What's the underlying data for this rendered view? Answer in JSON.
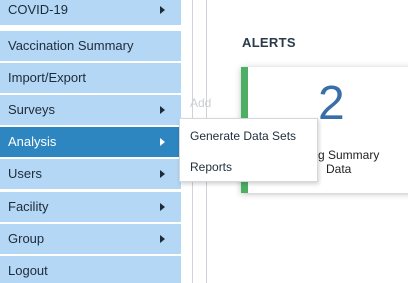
{
  "sidebar": {
    "items": [
      {
        "label": "COVID-19",
        "has_arrow": true,
        "active": false
      },
      {
        "label": "Vaccination Summary",
        "has_arrow": false,
        "active": false
      },
      {
        "label": "Import/Export",
        "has_arrow": false,
        "active": false
      },
      {
        "label": "Surveys",
        "has_arrow": true,
        "active": false
      },
      {
        "label": "Analysis",
        "has_arrow": true,
        "active": true
      },
      {
        "label": "Users",
        "has_arrow": true,
        "active": false
      },
      {
        "label": "Facility",
        "has_arrow": true,
        "active": false
      },
      {
        "label": "Group",
        "has_arrow": true,
        "active": false
      },
      {
        "label": "Logout",
        "has_arrow": false,
        "active": false
      }
    ]
  },
  "submenu": {
    "items": [
      {
        "label": "Generate Data Sets"
      },
      {
        "label": "Reports"
      }
    ]
  },
  "main": {
    "alerts_title": "ALERTS",
    "faint_add": "Add",
    "card": {
      "number": "2",
      "label_line1": "g Summary",
      "label_line2": "Data"
    }
  },
  "colors": {
    "nav_bg": "#b3d7f5",
    "nav_active_bg": "#2e86c1",
    "card_accent": "#4caf64",
    "number_color": "#3a6ea8"
  }
}
